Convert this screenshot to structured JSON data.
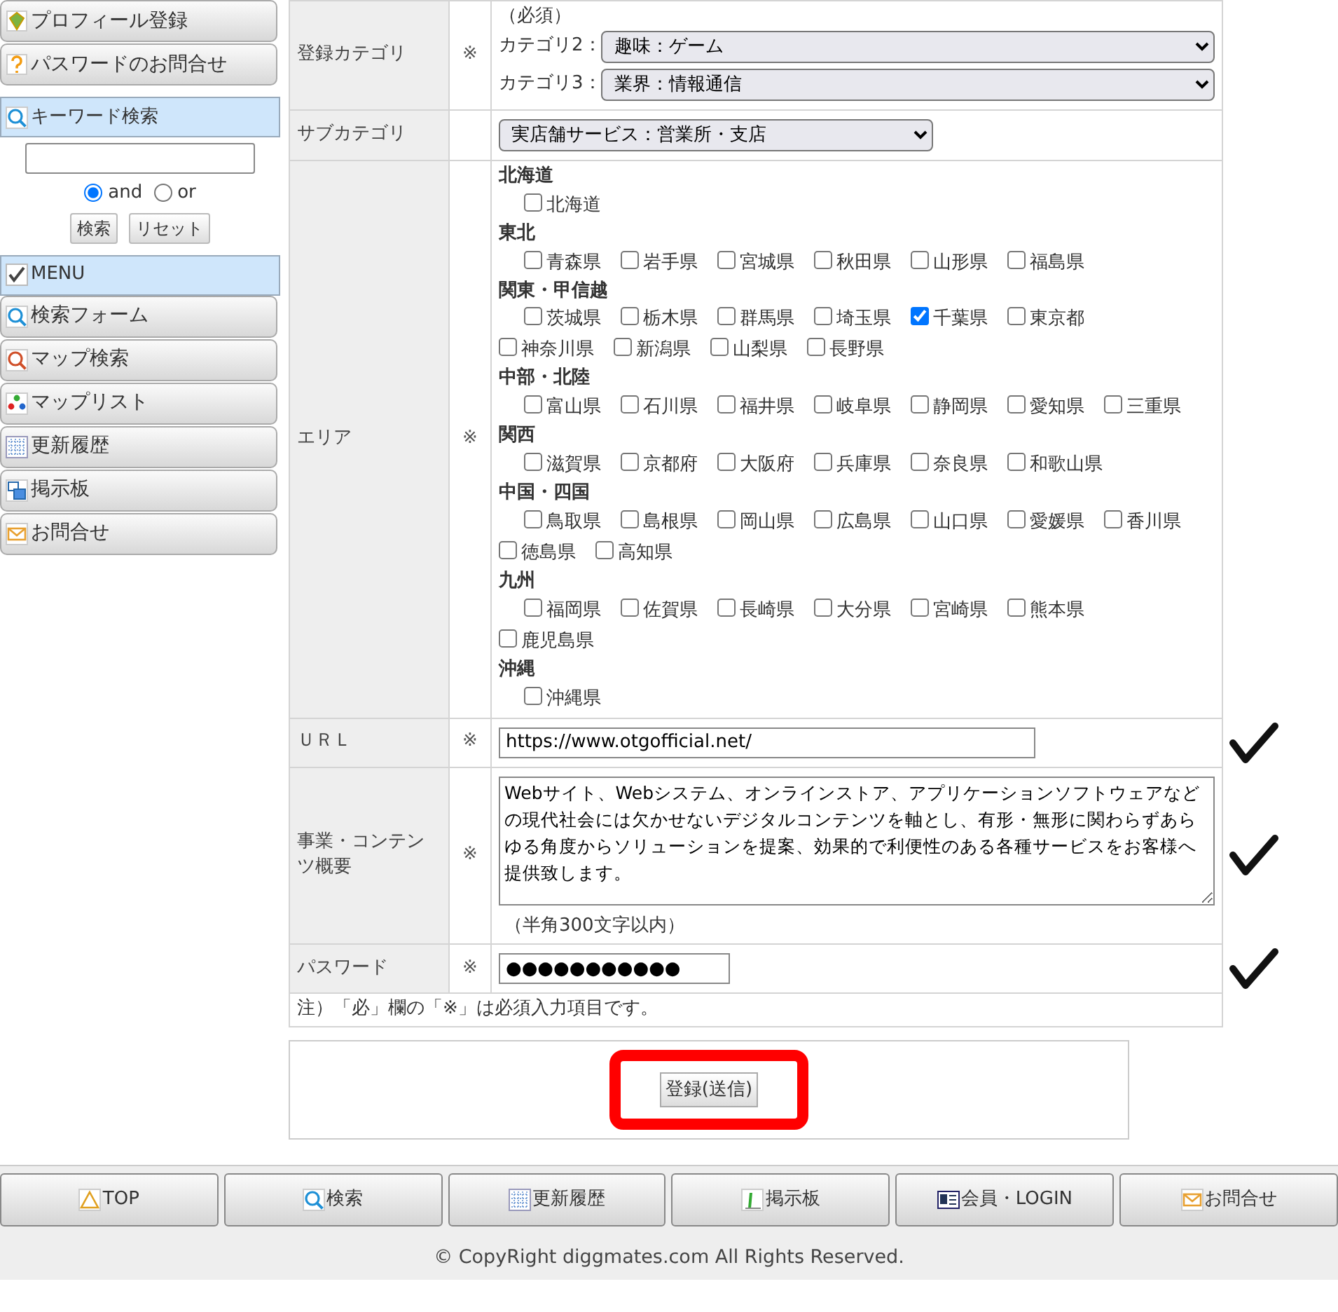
{
  "sidebar": {
    "top_buttons": [
      {
        "label": "プロフィール登録"
      },
      {
        "label": "パスワードのお問合せ"
      }
    ],
    "keyword_search": {
      "title": "キーワード検索",
      "options": [
        {
          "label": "and",
          "selected": true
        },
        {
          "label": "or",
          "selected": false
        }
      ],
      "buttons": [
        "検索",
        "リセット"
      ]
    },
    "menu": {
      "title": "MENU",
      "items": [
        {
          "label": "検索フォーム"
        },
        {
          "label": "マップ検索"
        },
        {
          "label": "マップリスト"
        },
        {
          "label": "更新履歴"
        },
        {
          "label": "掲示板"
        },
        {
          "label": "お問合せ"
        }
      ]
    }
  },
  "form": {
    "category": {
      "label": "登録カテゴリ",
      "mark": "※",
      "note": "（必須）",
      "selects": [
        {
          "label": "カテゴリ2：",
          "value": "趣味：ゲーム"
        },
        {
          "label": "カテゴリ3：",
          "value": "業界：情報通信"
        }
      ]
    },
    "sub_category": {
      "label": "サブカテゴリ",
      "value": "実店舗サービス：営業所・支店"
    },
    "area": {
      "label": "エリア",
      "mark": "※",
      "regions": [
        {
          "name": "北海道",
          "prefectures": [
            {
              "name": "北海道",
              "checked": false
            }
          ]
        },
        {
          "name": "東北",
          "prefectures": [
            {
              "name": "青森県",
              "checked": false
            },
            {
              "name": "岩手県",
              "checked": false
            },
            {
              "name": "宮城県",
              "checked": false
            },
            {
              "name": "秋田県",
              "checked": false
            },
            {
              "name": "山形県",
              "checked": false
            },
            {
              "name": "福島県",
              "checked": false
            }
          ]
        },
        {
          "name": "関東・甲信越",
          "prefectures": [
            {
              "name": "茨城県",
              "checked": false
            },
            {
              "name": "栃木県",
              "checked": false
            },
            {
              "name": "群馬県",
              "checked": false
            },
            {
              "name": "埼玉県",
              "checked": false
            },
            {
              "name": "千葉県",
              "checked": true
            },
            {
              "name": "東京都",
              "checked": false
            },
            {
              "name": "神奈川県",
              "checked": false
            },
            {
              "name": "新潟県",
              "checked": false
            },
            {
              "name": "山梨県",
              "checked": false
            },
            {
              "name": "長野県",
              "checked": false
            }
          ]
        },
        {
          "name": "中部・北陸",
          "prefectures": [
            {
              "name": "富山県",
              "checked": false
            },
            {
              "name": "石川県",
              "checked": false
            },
            {
              "name": "福井県",
              "checked": false
            },
            {
              "name": "岐阜県",
              "checked": false
            },
            {
              "name": "静岡県",
              "checked": false
            },
            {
              "name": "愛知県",
              "checked": false
            },
            {
              "name": "三重県",
              "checked": false
            }
          ]
        },
        {
          "name": "関西",
          "prefectures": [
            {
              "name": "滋賀県",
              "checked": false
            },
            {
              "name": "京都府",
              "checked": false
            },
            {
              "name": "大阪府",
              "checked": false
            },
            {
              "name": "兵庫県",
              "checked": false
            },
            {
              "name": "奈良県",
              "checked": false
            },
            {
              "name": "和歌山県",
              "checked": false
            }
          ]
        },
        {
          "name": "中国・四国",
          "prefectures": [
            {
              "name": "鳥取県",
              "checked": false
            },
            {
              "name": "島根県",
              "checked": false
            },
            {
              "name": "岡山県",
              "checked": false
            },
            {
              "name": "広島県",
              "checked": false
            },
            {
              "name": "山口県",
              "checked": false
            },
            {
              "name": "愛媛県",
              "checked": false
            },
            {
              "name": "香川県",
              "checked": false
            },
            {
              "name": "徳島県",
              "checked": false
            },
            {
              "name": "高知県",
              "checked": false
            }
          ]
        },
        {
          "name": "九州",
          "prefectures": [
            {
              "name": "福岡県",
              "checked": false
            },
            {
              "name": "佐賀県",
              "checked": false
            },
            {
              "name": "長崎県",
              "checked": false
            },
            {
              "name": "大分県",
              "checked": false
            },
            {
              "name": "宮崎県",
              "checked": false
            },
            {
              "name": "熊本県",
              "checked": false
            },
            {
              "name": "鹿児島県",
              "checked": false
            }
          ]
        },
        {
          "name": "沖縄",
          "prefectures": [
            {
              "name": "沖縄県",
              "checked": false
            }
          ]
        }
      ]
    },
    "url": {
      "label": "ＵＲＬ",
      "mark": "※",
      "value": "https://www.otgofficial.net/",
      "annotated": true
    },
    "summary": {
      "label": "事業・コンテンツ概要",
      "mark": "※",
      "value": "Webサイト、Webシステム、オンラインストア、アプリケーションソフトウェアなどの現代社会には欠かせないデジタルコンテンツを軸とし、有形・無形に関わらずあらゆる角度からソリューションを提案、効果的で利便性のある各種サービスをお客様へ提供致します。",
      "note": "（半角300文字以内）",
      "annotated": true
    },
    "password": {
      "label": "パスワード",
      "mark": "※",
      "value": "●●●●●●●●●●●",
      "annotated": true
    },
    "footnote": "注）「必」欄の「※」は必須入力項目です。",
    "submit": {
      "label": "登録(送信)",
      "highlighted": true
    }
  },
  "footer_nav": [
    {
      "label": "TOP"
    },
    {
      "label": "検索"
    },
    {
      "label": "更新履歴"
    },
    {
      "label": "掲示板"
    },
    {
      "label": "会員・LOGIN"
    },
    {
      "label": "お問合せ"
    }
  ],
  "copyright": "© CopyRight diggmates.com All Rights Reserved."
}
